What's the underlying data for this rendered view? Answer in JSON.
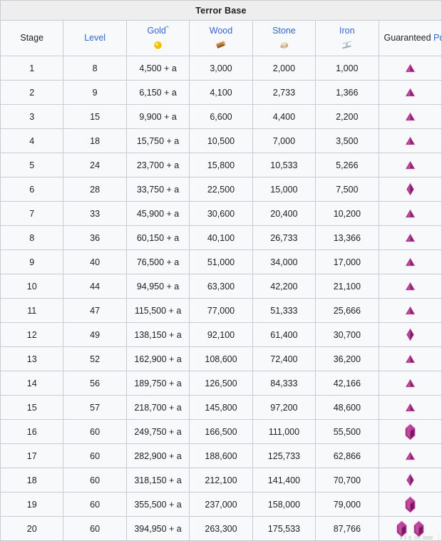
{
  "table": {
    "title": "Terror Base",
    "columns": [
      {
        "key": "stage",
        "label": "Stage",
        "link": false,
        "icon": null,
        "sup": ""
      },
      {
        "key": "level",
        "label": "Level",
        "link": true,
        "icon": null,
        "sup": ""
      },
      {
        "key": "gold",
        "label": "Gold",
        "link": true,
        "icon": "gold-coin-icon",
        "sup": "^"
      },
      {
        "key": "wood",
        "label": "Wood",
        "link": true,
        "icon": "wood-log-icon",
        "sup": ""
      },
      {
        "key": "stone",
        "label": "Stone",
        "link": true,
        "icon": "stone-rock-icon",
        "sup": ""
      },
      {
        "key": "iron",
        "label": "Iron",
        "link": true,
        "icon": "iron-beam-icon",
        "sup": ""
      },
      {
        "key": "stones",
        "label_plain": "Guaranteed ",
        "label_link": "Power Stones",
        "link": true,
        "icon": null,
        "sup": "^^"
      }
    ],
    "rows": [
      {
        "stage": "1",
        "level": "8",
        "gold": "4,500 + a",
        "wood": "3,000",
        "stone": "2,000",
        "iron": "1,000",
        "stones": [
          "triangle"
        ]
      },
      {
        "stage": "2",
        "level": "9",
        "gold": "6,150 + a",
        "wood": "4,100",
        "stone": "2,733",
        "iron": "1,366",
        "stones": [
          "triangle"
        ]
      },
      {
        "stage": "3",
        "level": "15",
        "gold": "9,900 + a",
        "wood": "6,600",
        "stone": "4,400",
        "iron": "2,200",
        "stones": [
          "triangle"
        ]
      },
      {
        "stage": "4",
        "level": "18",
        "gold": "15,750 + a",
        "wood": "10,500",
        "stone": "7,000",
        "iron": "3,500",
        "stones": [
          "triangle"
        ]
      },
      {
        "stage": "5",
        "level": "24",
        "gold": "23,700 + a",
        "wood": "15,800",
        "stone": "10,533",
        "iron": "5,266",
        "stones": [
          "triangle"
        ]
      },
      {
        "stage": "6",
        "level": "28",
        "gold": "33,750 + a",
        "wood": "22,500",
        "stone": "15,000",
        "iron": "7,500",
        "stones": [
          "diamond"
        ]
      },
      {
        "stage": "7",
        "level": "33",
        "gold": "45,900 + a",
        "wood": "30,600",
        "stone": "20,400",
        "iron": "10,200",
        "stones": [
          "triangle"
        ]
      },
      {
        "stage": "8",
        "level": "36",
        "gold": "60,150 + a",
        "wood": "40,100",
        "stone": "26,733",
        "iron": "13,366",
        "stones": [
          "triangle"
        ]
      },
      {
        "stage": "9",
        "level": "40",
        "gold": "76,500 + a",
        "wood": "51,000",
        "stone": "34,000",
        "iron": "17,000",
        "stones": [
          "triangle"
        ]
      },
      {
        "stage": "10",
        "level": "44",
        "gold": "94,950 + a",
        "wood": "63,300",
        "stone": "42,200",
        "iron": "21,100",
        "stones": [
          "triangle"
        ]
      },
      {
        "stage": "11",
        "level": "47",
        "gold": "115,500 + a",
        "wood": "77,000",
        "stone": "51,333",
        "iron": "25,666",
        "stones": [
          "triangle"
        ]
      },
      {
        "stage": "12",
        "level": "49",
        "gold": "138,150 + a",
        "wood": "92,100",
        "stone": "61,400",
        "iron": "30,700",
        "stones": [
          "diamond"
        ]
      },
      {
        "stage": "13",
        "level": "52",
        "gold": "162,900 + a",
        "wood": "108,600",
        "stone": "72,400",
        "iron": "36,200",
        "stones": [
          "triangle"
        ]
      },
      {
        "stage": "14",
        "level": "56",
        "gold": "189,750 + a",
        "wood": "126,500",
        "stone": "84,333",
        "iron": "42,166",
        "stones": [
          "triangle"
        ]
      },
      {
        "stage": "15",
        "level": "57",
        "gold": "218,700 + a",
        "wood": "145,800",
        "stone": "97,200",
        "iron": "48,600",
        "stones": [
          "triangle"
        ]
      },
      {
        "stage": "16",
        "level": "60",
        "gold": "249,750 + a",
        "wood": "166,500",
        "stone": "111,000",
        "iron": "55,500",
        "stones": [
          "crystal"
        ]
      },
      {
        "stage": "17",
        "level": "60",
        "gold": "282,900 + a",
        "wood": "188,600",
        "stone": "125,733",
        "iron": "62,866",
        "stones": [
          "triangle"
        ]
      },
      {
        "stage": "18",
        "level": "60",
        "gold": "318,150 + a",
        "wood": "212,100",
        "stone": "141,400",
        "iron": "70,700",
        "stones": [
          "diamond"
        ]
      },
      {
        "stage": "19",
        "level": "60",
        "gold": "355,500 + a",
        "wood": "237,000",
        "stone": "158,000",
        "iron": "79,000",
        "stones": [
          "crystal"
        ]
      },
      {
        "stage": "20",
        "level": "60",
        "gold": "394,950 + a",
        "wood": "263,300",
        "stone": "175,533",
        "iron": "87,766",
        "stones": [
          "crystal",
          "crystal"
        ]
      }
    ]
  },
  "colors": {
    "link": "#3366cc",
    "text": "#202122",
    "border": "#c8ccd1",
    "cell_bg": "#f8f9fa",
    "title_bg": "#eeeeee",
    "gem_purple": "#a1247e",
    "gem_light": "#d06bb5",
    "gold": "#f2c200",
    "wood": "#b5763a",
    "stone": "#d9c3a4",
    "iron": "#9aa2ad"
  }
}
